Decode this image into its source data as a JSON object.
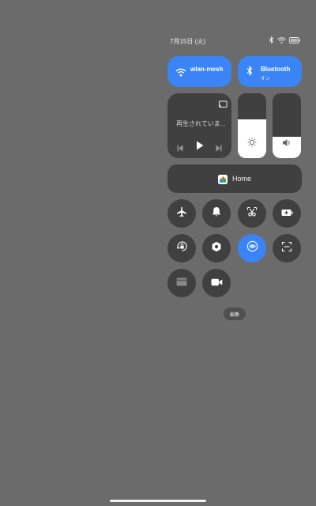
{
  "status": {
    "date": "7月15日 (火)"
  },
  "wifi": {
    "label": "wlan-mesh",
    "sub": ""
  },
  "bluetooth": {
    "label": "Bluetooth",
    "sub": "オン"
  },
  "media": {
    "status_text": "再生されていま..."
  },
  "sliders": {
    "brightness": 0.6,
    "volume": 0.33
  },
  "home": {
    "label": "Home"
  },
  "edit": {
    "label": "編集"
  },
  "colors": {
    "accent": "#3a84f6",
    "tile": "#404040",
    "background": "#6b6b6b"
  }
}
